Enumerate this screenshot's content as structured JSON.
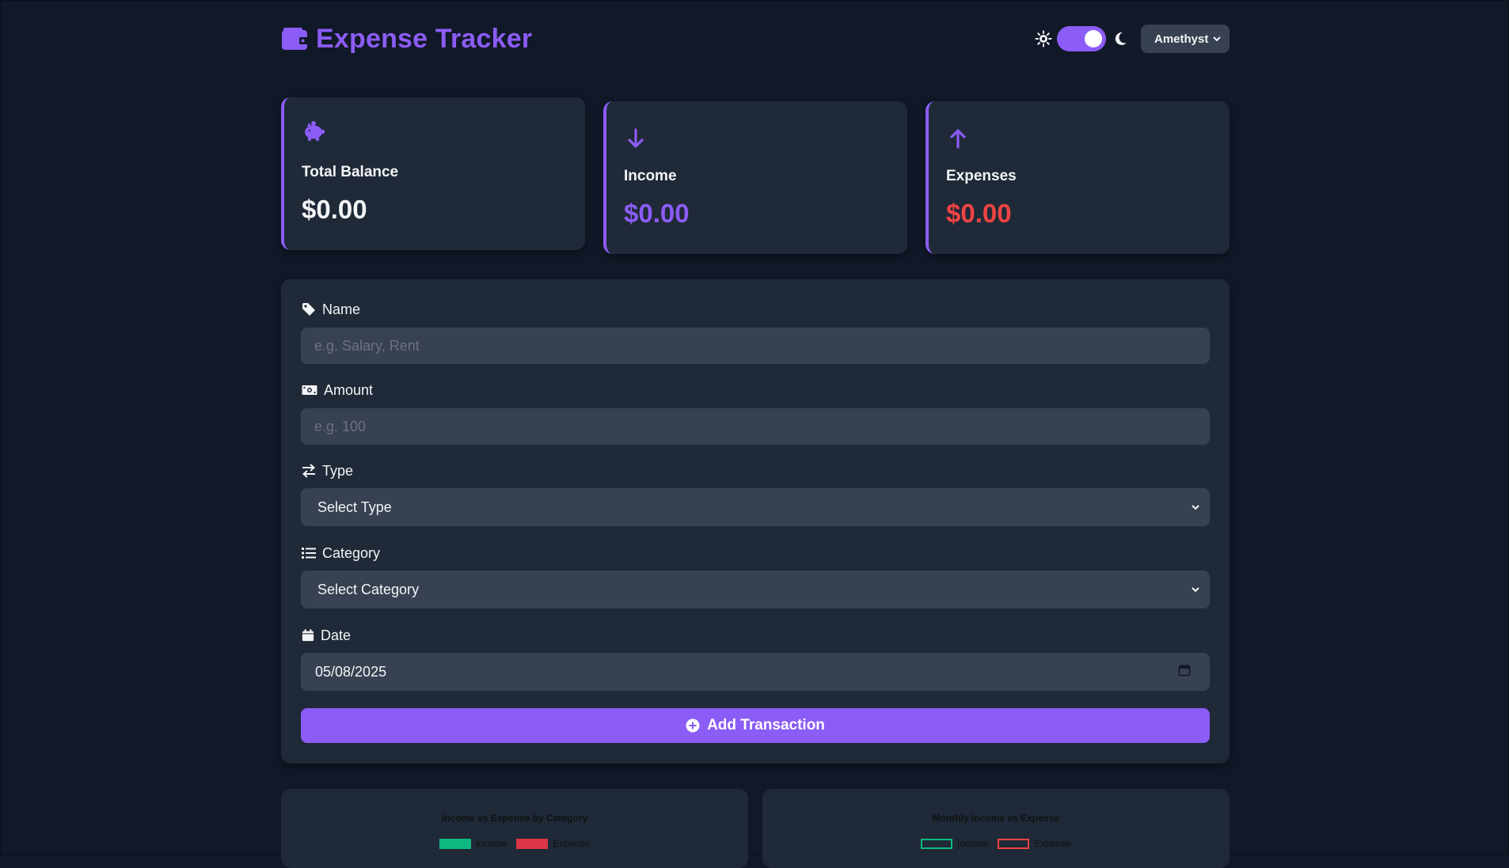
{
  "app": {
    "title": "Expense Tracker"
  },
  "theme": {
    "selected": "Amethyst",
    "dark_mode": true,
    "accent": "#8b5cf6"
  },
  "summary": {
    "balance": {
      "label": "Total Balance",
      "value": "$0.00",
      "color": "#f3f4f6"
    },
    "income": {
      "label": "Income",
      "value": "$0.00",
      "color": "#8b5cf6"
    },
    "expenses": {
      "label": "Expenses",
      "value": "$0.00",
      "color": "#ef4444"
    }
  },
  "form": {
    "name": {
      "label": "Name",
      "placeholder": "e.g. Salary, Rent"
    },
    "amount": {
      "label": "Amount",
      "placeholder": "e.g. 100"
    },
    "type": {
      "label": "Type",
      "selected": "Select Type"
    },
    "category": {
      "label": "Category",
      "selected": "Select Category"
    },
    "date": {
      "label": "Date",
      "value": "05/08/2025"
    },
    "submit_label": "Add Transaction"
  },
  "charts": [
    {
      "title": "Income vs Expense by Category",
      "legend": [
        "Income",
        "Expense"
      ],
      "legend_style": "filled"
    },
    {
      "title": "Monthly Income vs Expense",
      "legend": [
        "Income",
        "Expense"
      ],
      "legend_style": "outline"
    }
  ],
  "colors": {
    "income": "#10b981",
    "expense": "#ef4444",
    "background": "#111827",
    "card": "#1f2937",
    "input": "#374151"
  }
}
